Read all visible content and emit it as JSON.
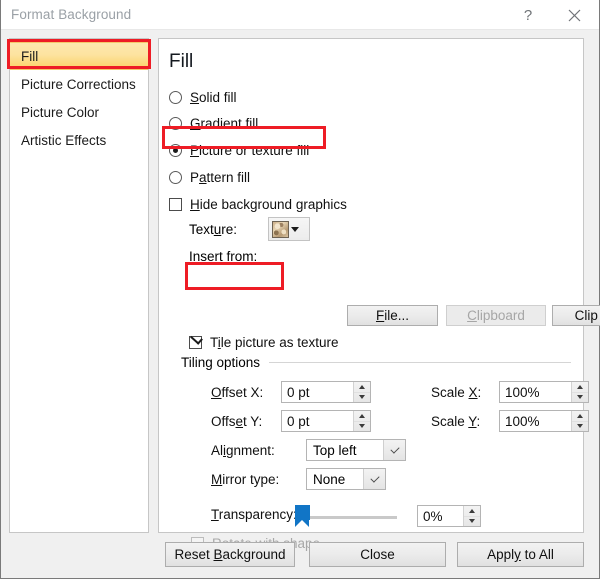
{
  "window": {
    "title": "Format Background",
    "help_icon": "question-mark-icon",
    "close_icon": "close-icon"
  },
  "sidebar": {
    "items": [
      {
        "label": "Fill",
        "selected": true
      },
      {
        "label": "Picture Corrections",
        "selected": false
      },
      {
        "label": "Picture Color",
        "selected": false
      },
      {
        "label": "Artistic Effects",
        "selected": false
      }
    ]
  },
  "main": {
    "heading": "Fill",
    "fill_options": [
      {
        "label": "Solid fill",
        "accel": "S",
        "checked": false
      },
      {
        "label": "Gradient fill",
        "accel": "G",
        "checked": false
      },
      {
        "label": "Picture or texture fill",
        "accel": "P",
        "checked": true
      },
      {
        "label": "Pattern fill",
        "accel": "A",
        "checked": false
      }
    ],
    "hide_background": {
      "label": "Hide background graphics",
      "accel": "H",
      "checked": false
    },
    "texture": {
      "label": "Texture:",
      "accel": "u",
      "swatch": "texture-swatch-papyrus",
      "dropdown_icon": "caret-down-icon"
    },
    "insert_from": {
      "label": "Insert from:"
    },
    "insert_buttons": [
      {
        "label": "File...",
        "accel": "F",
        "disabled": false
      },
      {
        "label": "Clipboard",
        "accel": "C",
        "disabled": true
      },
      {
        "label": "Clip Art...",
        "accel": "r",
        "disabled": false
      }
    ],
    "tile_picture": {
      "label": "Tile picture as texture",
      "accel": "i",
      "checked": true
    },
    "tiling_options": {
      "label": "Tiling options"
    },
    "fields": {
      "offset_x": {
        "label": "Offset X:",
        "accel": "O",
        "value": "0 pt"
      },
      "offset_y": {
        "label": "Offset Y:",
        "accel": "e",
        "value": "0 pt"
      },
      "scale_x": {
        "label": "Scale X:",
        "accel": "X",
        "value": "100%"
      },
      "scale_y": {
        "label": "Scale Y:",
        "accel": "Y",
        "value": "100%"
      },
      "alignment": {
        "label": "Alignment:",
        "accel": "i",
        "value": "Top left"
      },
      "mirror_type": {
        "label": "Mirror type:",
        "accel": "M",
        "value": "None"
      },
      "transparency": {
        "label": "Transparency:",
        "accel": "T",
        "value": "0%",
        "slider_percent": 0
      },
      "rotate_with_shape": {
        "label": "Rotate with shape",
        "accel": "w",
        "checked": false,
        "disabled": true
      }
    }
  },
  "footer": {
    "buttons": [
      {
        "label": "Reset Background",
        "accel": "B"
      },
      {
        "label": "Close",
        "accel": ""
      },
      {
        "label": "Apply to All",
        "accel": "y"
      }
    ]
  },
  "annotations": {
    "color": "#ee1c25",
    "highlights": [
      "sidebar-item-fill",
      "picture-or-texture-fill-radio",
      "file-button"
    ]
  }
}
